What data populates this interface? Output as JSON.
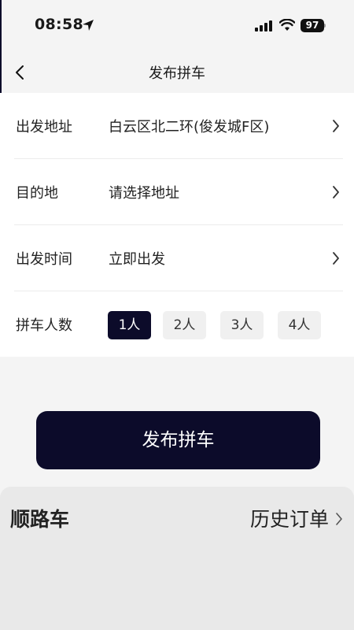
{
  "status_bar": {
    "time": "08:58",
    "battery": "97"
  },
  "nav": {
    "title": "发布拼车"
  },
  "form": {
    "departure": {
      "label": "出发地址",
      "value": "白云区北二环(俊发城F区)"
    },
    "destination": {
      "label": "目的地",
      "value": "请选择地址"
    },
    "time": {
      "label": "出发时间",
      "value": "立即出发"
    },
    "passengers": {
      "label": "拼车人数",
      "options": [
        "1人",
        "2人",
        "3人",
        "4人"
      ],
      "selected_index": 0
    }
  },
  "publish_button": "发布拼车",
  "bottom_panel": {
    "title": "顺路车",
    "history_link": "历史订单"
  },
  "colors": {
    "accent": "#0c0b2a",
    "background": "#f4f4f4"
  }
}
